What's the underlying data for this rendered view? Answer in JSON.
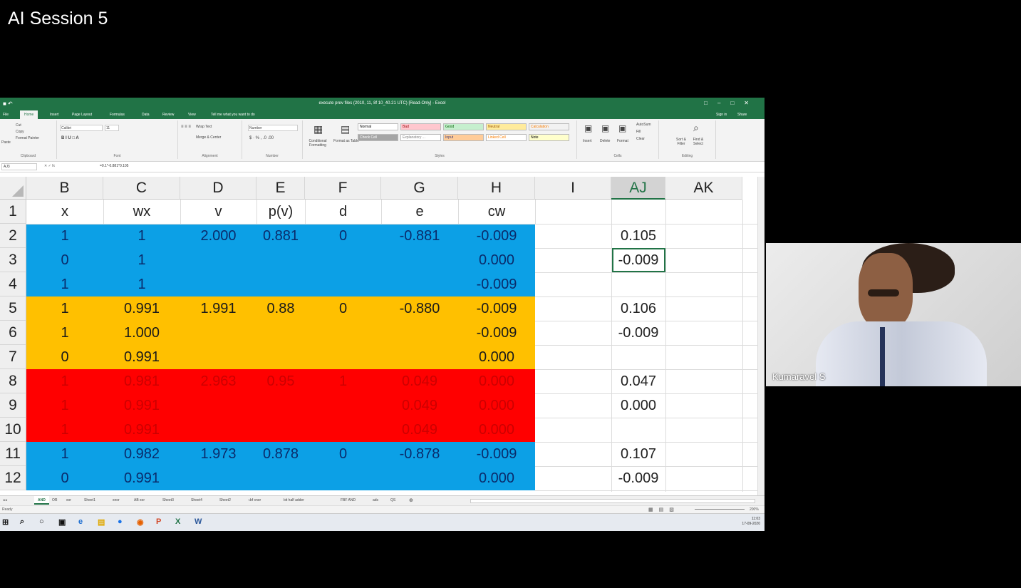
{
  "meeting": {
    "title": "AI Session 5",
    "participant_name": "Kumaravel S"
  },
  "excel": {
    "window_title": "execute prev files (2010, 11, 8f 10_40.21 UTC) [Read-Only] - Excel",
    "ribbon_tabs": [
      "File",
      "Home",
      "Insert",
      "Page Layout",
      "Formulas",
      "Data",
      "Review",
      "View",
      "Tell me what you want to do"
    ],
    "active_tab": "Home",
    "account": [
      "Sign in",
      "Share"
    ],
    "ribbon_groups": [
      "Clipboard",
      "Font",
      "Alignment",
      "Number",
      "Styles",
      "Cells",
      "Editing"
    ],
    "ribbon": {
      "clipboard": [
        "Cut",
        "Copy",
        "Format Painter",
        "Paste"
      ],
      "font_name": "Calibri",
      "font_size": "11",
      "alignment": [
        "Wrap Text",
        "Merge & Center"
      ],
      "number_format": "Number",
      "styles_buttons": [
        "Conditional Formatting",
        "Format as Table"
      ],
      "styles": [
        {
          "label": "Normal",
          "bg": "#ffffff",
          "fg": "#000000"
        },
        {
          "label": "Bad",
          "bg": "#ffc7ce",
          "fg": "#9c0006"
        },
        {
          "label": "Good",
          "bg": "#c6efce",
          "fg": "#006100"
        },
        {
          "label": "Neutral",
          "bg": "#ffeb9c",
          "fg": "#9c5700"
        },
        {
          "label": "Calculation",
          "bg": "#f2f2f2",
          "fg": "#fa7d00"
        },
        {
          "label": "Check Cell",
          "bg": "#a5a5a5",
          "fg": "#ffffff"
        },
        {
          "label": "Explanatory ...",
          "bg": "#ffffff",
          "fg": "#7f7f7f"
        },
        {
          "label": "Input",
          "bg": "#ffcc99",
          "fg": "#3f3f76"
        },
        {
          "label": "Linked Cell",
          "bg": "#ffffff",
          "fg": "#fa7d00"
        },
        {
          "label": "Note",
          "bg": "#ffffcc",
          "fg": "#000000"
        }
      ],
      "cells": [
        "Insert",
        "Delete",
        "Format"
      ],
      "editing": [
        "AutoSum",
        "Fill",
        "Clear",
        "Sort & Filter",
        "Find & Select"
      ]
    },
    "name_box": "AJ3",
    "formula": "=0.1*-0.881*0.105",
    "columns": [
      "B",
      "C",
      "D",
      "E",
      "F",
      "G",
      "H",
      "I",
      "AJ",
      "AK"
    ],
    "selected_column": "AJ",
    "row_numbers": [
      "1",
      "2",
      "3",
      "4",
      "5",
      "6",
      "7",
      "8",
      "9",
      "10",
      "11",
      "12"
    ],
    "header_row": [
      "x",
      "wx",
      "v",
      "p(v)",
      "d",
      "e",
      "cw",
      "",
      "",
      ""
    ],
    "rows": [
      {
        "band": "blue",
        "cells": [
          "1",
          "1",
          "2.000",
          "0.881",
          "0",
          "-0.881",
          "-0.009",
          "",
          "0.105",
          ""
        ]
      },
      {
        "band": "blue",
        "cells": [
          "0",
          "1",
          "",
          "",
          "",
          "",
          "0.000",
          "",
          "-0.009",
          ""
        ]
      },
      {
        "band": "blue",
        "cells": [
          "1",
          "1",
          "",
          "",
          "",
          "",
          "-0.009",
          "",
          "",
          ""
        ]
      },
      {
        "band": "orange",
        "cells": [
          "1",
          "0.991",
          "1.991",
          "0.88",
          "0",
          "-0.880",
          "-0.009",
          "",
          "0.106",
          ""
        ]
      },
      {
        "band": "orange",
        "cells": [
          "1",
          "1.000",
          "",
          "",
          "",
          "",
          "-0.009",
          "",
          "-0.009",
          ""
        ]
      },
      {
        "band": "orange",
        "cells": [
          "0",
          "0.991",
          "",
          "",
          "",
          "",
          "0.000",
          "",
          "",
          ""
        ]
      },
      {
        "band": "red",
        "cells": [
          "1",
          "0.981",
          "2.963",
          "0.95",
          "1",
          "0.049",
          "0.000",
          "",
          "0.047",
          ""
        ]
      },
      {
        "band": "red",
        "cells": [
          "1",
          "0.991",
          "",
          "",
          "",
          "0.049",
          "0.000",
          "",
          "0.000",
          ""
        ]
      },
      {
        "band": "red",
        "cells": [
          "1",
          "0.991",
          "",
          "",
          "",
          "0.049",
          "0.000",
          "",
          "",
          ""
        ]
      },
      {
        "band": "blue",
        "cells": [
          "1",
          "0.982",
          "1.973",
          "0.878",
          "0",
          "-0.878",
          "-0.009",
          "",
          "0.107",
          ""
        ]
      },
      {
        "band": "blue",
        "cells": [
          "0",
          "0.991",
          "",
          "",
          "",
          "",
          "0.000",
          "",
          "-0.009",
          ""
        ]
      }
    ],
    "band_colors": {
      "blue": "#0ca0e6",
      "orange": "#ffc000",
      "red": "#ff0000"
    },
    "band_text_colors": {
      "blue": "#0a2b6b",
      "orange": "#1a1a1a",
      "red": "#cc0000"
    },
    "sheet_tabs": [
      "AND",
      "OR",
      "xor",
      "Sheet1",
      "xnor",
      "AB xor",
      "Sheet3",
      "Sheet4",
      "Sheet2",
      "¬bf xnor",
      "bit half adder",
      "FBF AND",
      "ads",
      "QS"
    ],
    "active_sheet": "AND",
    "status": {
      "mode": "Ready",
      "zoom": "200%"
    },
    "taskbar_time": "11:03",
    "taskbar_date": "17-09-2020"
  }
}
